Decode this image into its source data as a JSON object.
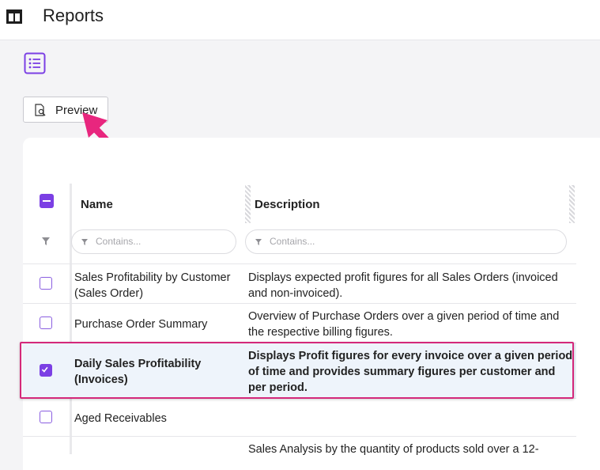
{
  "app": {
    "title": "Reports"
  },
  "toolbar": {
    "preview_label": "Preview"
  },
  "table": {
    "columns": {
      "name": "Name",
      "description": "Description"
    },
    "filters": {
      "name_placeholder": "Contains...",
      "description_placeholder": "Contains..."
    },
    "rows": [
      {
        "name": "Sales Profitability by Customer (Sales Order)",
        "description": "Displays expected profit figures for all Sales Orders (invoiced and non-invoiced).",
        "checked": false
      },
      {
        "name": "Purchase Order Summary",
        "description": "Overview of Purchase Orders over a given period of time and the respective billing figures.",
        "checked": false
      },
      {
        "name": "Daily Sales Profitability (Invoices)",
        "description": "Displays Profit figures for every invoice over a given period of time and provides summary figures per customer and per period.",
        "checked": true
      },
      {
        "name": "Aged Receivables",
        "description": "",
        "checked": false
      },
      {
        "name": "",
        "description": "Sales Analysis by the quantity of products sold over a 12-",
        "checked": false
      }
    ]
  },
  "colors": {
    "accent": "#7b3fe4",
    "highlight": "#d4287a",
    "selected_row": "#eef4fb"
  },
  "icons": [
    "table-icon",
    "list-icon",
    "preview-icon",
    "filter-icon",
    "checkmark-icon",
    "arrow-annotation"
  ]
}
